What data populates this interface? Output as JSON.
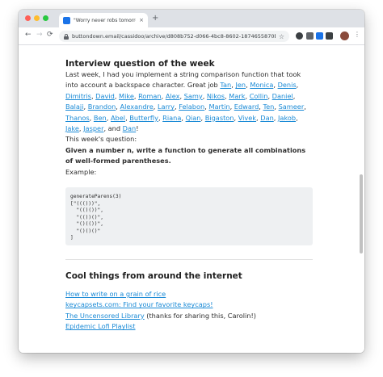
{
  "browser": {
    "tab_title": "\"Worry never robs tomorrow...",
    "tab_close": "×",
    "new_tab": "+",
    "url": "buttondown.email/cassidoo/archive/d808b752-d066-4bc8-8602-1874655870b7",
    "back": "←",
    "forward": "→",
    "reload": "⟳",
    "star": "☆",
    "menu": "⋮"
  },
  "article": {
    "heading_interview": "Interview question of the week",
    "intro_text": "Last week, I had you implement a string comparison function that took into account a backspace character. Great job",
    "names": [
      "Tan",
      "Jen",
      "Monica",
      "Denis",
      "Dimitris",
      "David",
      "Mike",
      "Roman",
      "Alex",
      "Samy",
      "Nikos",
      "Mark",
      "Collin",
      "Daniel",
      "Balaji",
      "Brandon",
      "Alexandre",
      "Larry",
      "Felabon",
      "Martin",
      "Edward",
      "Ten",
      "Sameer",
      "Thanos",
      "Ben",
      "Abel",
      "Butterfly",
      "Riana",
      "Qian",
      "Bigaston",
      "Vivek",
      "Dan",
      "Jakob",
      "Jake",
      "Jasper"
    ],
    "last_name": "Dan",
    "and_text": "and",
    "question_label": "This week's question:",
    "question": "Given a number n, write a function to generate all combinations of well-formed parentheses.",
    "example_label": "Example:",
    "code": "generateParens(3)\n[\"((()))\",\n  \"(()())\",\n  \"(())()\",\n  \"()(())\",\n  \"()()()\"\n]",
    "heading_cool": "Cool things from around the internet",
    "links": [
      {
        "text": "How to write on a grain of rice",
        "suffix": ""
      },
      {
        "text": "keycapsets.com: Find your favorite keycaps!",
        "suffix": ""
      },
      {
        "text": "The Uncensored Library",
        "suffix": " (thanks for sharing this, Carolin!)"
      },
      {
        "text": "Epidemic Lofi Playlist",
        "suffix": ""
      }
    ]
  }
}
